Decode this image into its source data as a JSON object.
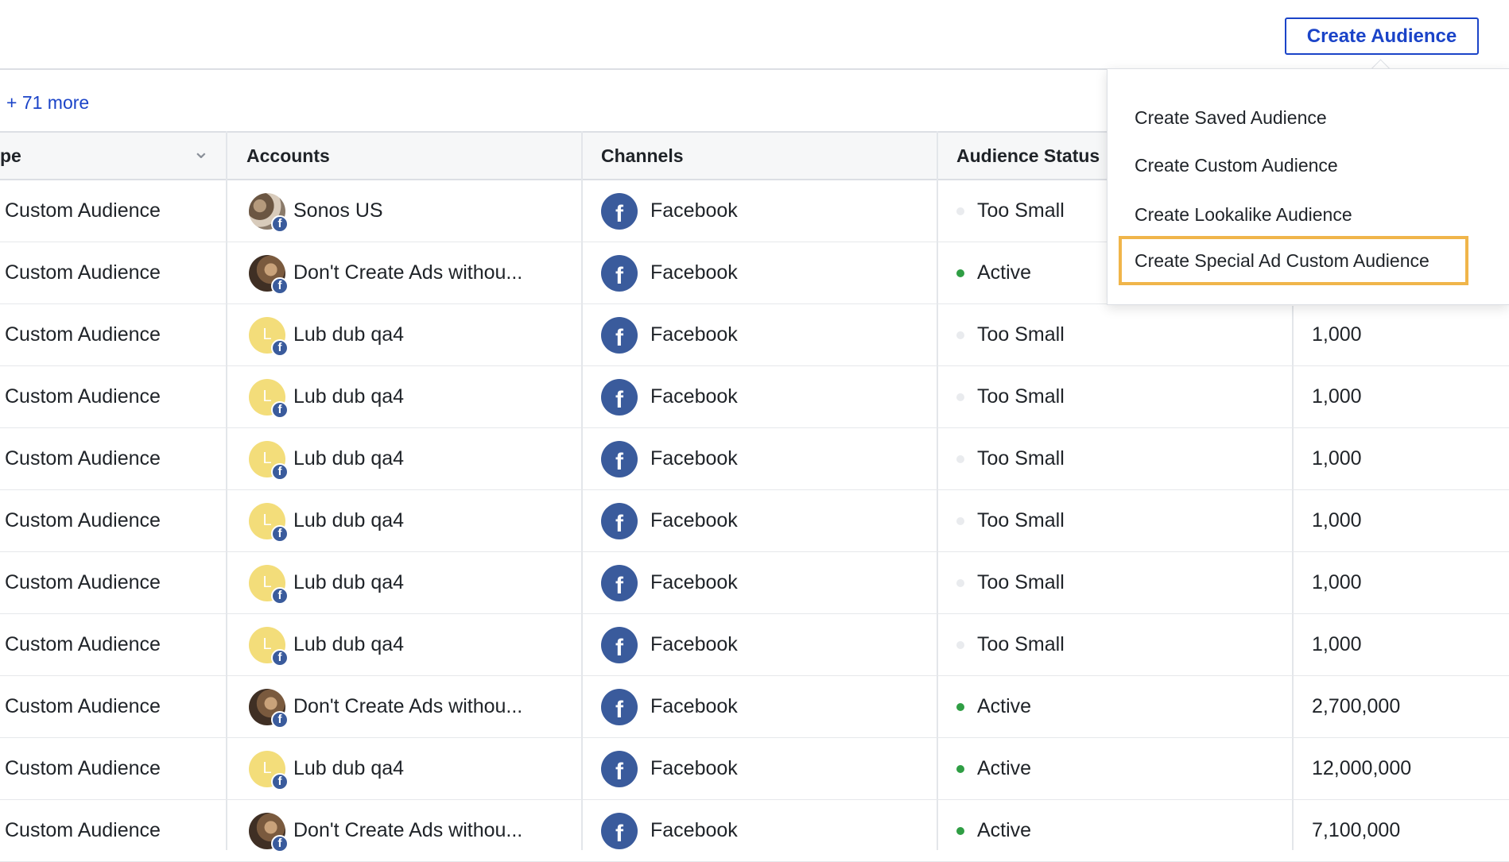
{
  "header": {
    "create_button": "Create Audience"
  },
  "filters": {
    "more_link": "+ 71 more"
  },
  "table": {
    "columns": [
      "pe",
      "Accounts",
      "Channels",
      "Audience Status"
    ],
    "rows": [
      {
        "type": "Custom Audience",
        "account": "Sonos US",
        "avatar": "photo",
        "channel": "Facebook",
        "status": "Too Small",
        "status_kind": "small",
        "size": ""
      },
      {
        "type": "Custom Audience",
        "account": "Don't Create Ads withou...",
        "avatar": "photo2",
        "channel": "Facebook",
        "status": "Active",
        "status_kind": "active",
        "size": ""
      },
      {
        "type": "Custom Audience",
        "account": "Lub dub qa4",
        "avatar": "letter",
        "channel": "Facebook",
        "status": "Too Small",
        "status_kind": "small",
        "size": "1,000"
      },
      {
        "type": "Custom Audience",
        "account": "Lub dub qa4",
        "avatar": "letter",
        "channel": "Facebook",
        "status": "Too Small",
        "status_kind": "small",
        "size": "1,000"
      },
      {
        "type": "Custom Audience",
        "account": "Lub dub qa4",
        "avatar": "letter",
        "channel": "Facebook",
        "status": "Too Small",
        "status_kind": "small",
        "size": "1,000"
      },
      {
        "type": "Custom Audience",
        "account": "Lub dub qa4",
        "avatar": "letter",
        "channel": "Facebook",
        "status": "Too Small",
        "status_kind": "small",
        "size": "1,000"
      },
      {
        "type": "Custom Audience",
        "account": "Lub dub qa4",
        "avatar": "letter",
        "channel": "Facebook",
        "status": "Too Small",
        "status_kind": "small",
        "size": "1,000"
      },
      {
        "type": "Custom Audience",
        "account": "Lub dub qa4",
        "avatar": "letter",
        "channel": "Facebook",
        "status": "Too Small",
        "status_kind": "small",
        "size": "1,000"
      },
      {
        "type": "Custom Audience",
        "account": "Don't Create Ads withou...",
        "avatar": "photo2",
        "channel": "Facebook",
        "status": "Active",
        "status_kind": "active",
        "size": "2,700,000"
      },
      {
        "type": "Custom Audience",
        "account": "Lub dub qa4",
        "avatar": "letter",
        "channel": "Facebook",
        "status": "Active",
        "status_kind": "active",
        "size": "12,000,000"
      },
      {
        "type": "Custom Audience",
        "account": "Don't Create Ads withou...",
        "avatar": "photo2",
        "channel": "Facebook",
        "status": "Active",
        "status_kind": "active",
        "size": "7,100,000"
      }
    ]
  },
  "dropdown": {
    "items": [
      "Create Saved Audience",
      "Create Custom Audience",
      "Create Lookalike Audience",
      "Create Special Ad Custom Audience"
    ]
  },
  "glyphs": {
    "avatar_letter": "L",
    "fb_letter": "f",
    "chevron": "⌄"
  },
  "colors": {
    "accent": "#1b44c8",
    "facebook": "#3a5b9c",
    "active": "#2f9e44",
    "highlight": "#f0b54a"
  }
}
